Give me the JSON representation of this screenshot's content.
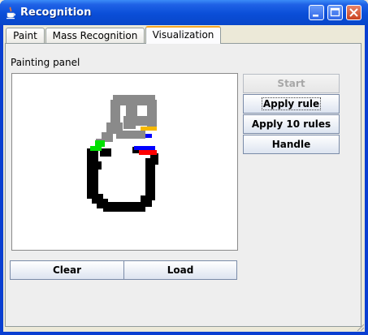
{
  "window": {
    "title": "Recognition",
    "icon": "java-cup-icon",
    "controls": [
      "minimize-icon",
      "maximize-icon",
      "close-icon"
    ]
  },
  "tabs": [
    {
      "label": "Paint",
      "active": false
    },
    {
      "label": "Mass Recognition",
      "active": false
    },
    {
      "label": "Visualization",
      "active": true
    }
  ],
  "visualization": {
    "panel_label": "Painting panel",
    "buttons": {
      "start": {
        "label": "Start",
        "enabled": false
      },
      "apply_rule": {
        "label": "Apply rule",
        "enabled": true,
        "focused": true
      },
      "apply_10_rules": {
        "label": "Apply 10 rules",
        "enabled": true
      },
      "handle": {
        "label": "Handle",
        "enabled": true
      }
    },
    "bottom_buttons": {
      "clear": "Clear",
      "load": "Load"
    },
    "drawing_colors": {
      "upper_stroke": "#8a8a8a",
      "lower_stroke": "#000000",
      "marker_yellow": "#f5b800",
      "marker_blue": "#0000ff",
      "marker_green": "#00e000",
      "marker_red": "#ff0000"
    }
  }
}
